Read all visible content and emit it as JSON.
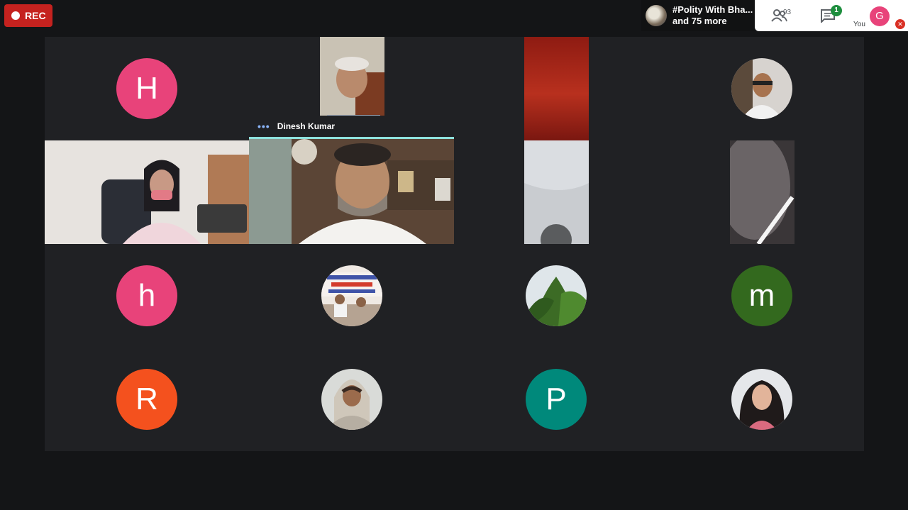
{
  "recording": {
    "label": "REC"
  },
  "meeting": {
    "title": "#Polity With Bha...",
    "subtitle": "and 75 more"
  },
  "toolbar": {
    "participants_count": "93",
    "chat_badge": "1",
    "you_initial": "G",
    "you_label": "You"
  },
  "tiles": {
    "r1c1_initial": "H",
    "r3c1_initial": "h",
    "r3c4_initial": "m",
    "r4c1_initial": "R",
    "r4c3_initial": "P"
  },
  "active_speaker": {
    "name": "Dinesh Kumar"
  },
  "colors": {
    "rec_red": "#c5221f",
    "avatar_pink": "#e8437a",
    "avatar_green": "#33691e",
    "avatar_orange": "#f4511e",
    "avatar_teal": "#00897b",
    "active_border": "#8ee1dc"
  }
}
